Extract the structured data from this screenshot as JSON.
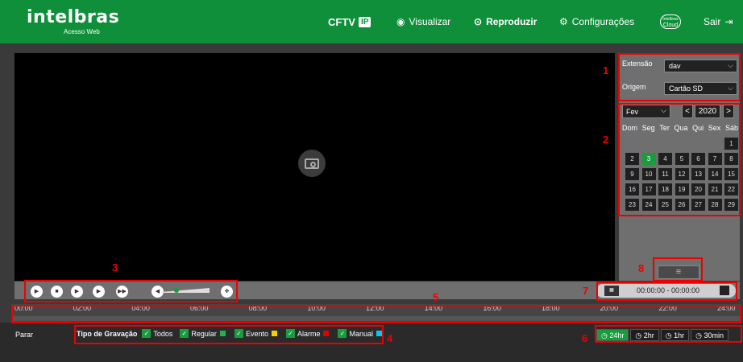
{
  "header": {
    "brand": "intelbras",
    "subtitle": "Acesso Web",
    "cftv": "CFTV",
    "ip": "IP",
    "visualizar": "Visualizar",
    "reproduzir": "Reproduzir",
    "configuracoes": "Configurações",
    "cloud_top": "intelbras",
    "cloud_bottom": "Cloud",
    "sair": "Sair"
  },
  "filters": {
    "extensao_label": "Extensão",
    "extensao_value": "dav",
    "origem_label": "Origem",
    "origem_value": "Cartão SD"
  },
  "calendar": {
    "month": "Fev",
    "year": "2020",
    "prev": "<",
    "next": ">",
    "day_names": [
      "Dom",
      "Seg",
      "Ter",
      "Qua",
      "Qui",
      "Sex",
      "Sáb"
    ],
    "days": [
      "1",
      "2",
      "3",
      "4",
      "5",
      "6",
      "7",
      "8",
      "9",
      "10",
      "11",
      "12",
      "13",
      "14",
      "15",
      "16",
      "17",
      "18",
      "19",
      "20",
      "21",
      "22",
      "23",
      "24",
      "25",
      "26",
      "27",
      "28",
      "29"
    ],
    "selected_day": "3",
    "first_weekday": 6
  },
  "time_range": "00:00:00 - 00:00:00",
  "timeline_ticks": [
    "00:00",
    "02:00",
    "04:00",
    "06:00",
    "08:00",
    "10:00",
    "12:00",
    "14:00",
    "16:00",
    "18:00",
    "20:00",
    "22:00",
    "24:00"
  ],
  "bottom": {
    "status": "Parar",
    "rec_title": "Tipo de Gravação",
    "rec_types": [
      {
        "label": "Todos",
        "color": ""
      },
      {
        "label": "Regular",
        "color": "#22b14c"
      },
      {
        "label": "Evento",
        "color": "#f5d000"
      },
      {
        "label": "Alarme",
        "color": "#e00000"
      },
      {
        "label": "Manual",
        "color": "#00c8ff"
      }
    ],
    "ranges": [
      "24hr",
      "2hr",
      "1hr",
      "30min"
    ]
  },
  "annotations": [
    "1",
    "2",
    "3",
    "4",
    "5",
    "6",
    "7",
    "8"
  ],
  "colors": {
    "brand": "#0f8f3a",
    "annotation": "#e00000",
    "selected": "#1a9c3e"
  }
}
